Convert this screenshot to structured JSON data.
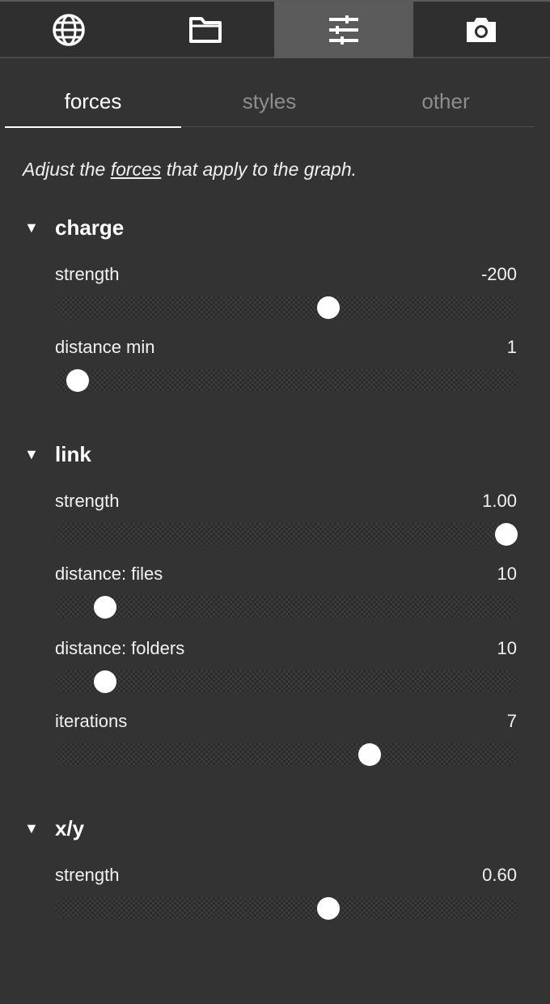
{
  "toolbar": {
    "buttons": [
      {
        "icon": "globe-icon"
      },
      {
        "icon": "folder-icon"
      },
      {
        "icon": "sliders-icon",
        "active": true
      },
      {
        "icon": "camera-icon"
      }
    ]
  },
  "tabs": [
    {
      "label": "forces",
      "active": true
    },
    {
      "label": "styles"
    },
    {
      "label": "other"
    }
  ],
  "intro": {
    "before": "Adjust the ",
    "link": "forces",
    "after": " that apply to the graph."
  },
  "sections": {
    "charge": {
      "caret": "▼",
      "title": "charge",
      "rows": [
        {
          "label": "strength",
          "value": "-200",
          "fraction": 0.596
        },
        {
          "label": "distance min",
          "value": "1",
          "fraction": 0.025
        }
      ]
    },
    "link": {
      "caret": "▼",
      "title": "link",
      "rows": [
        {
          "label": "strength",
          "value": "1.00",
          "fraction": 1.0
        },
        {
          "label": "distance: files",
          "value": "10",
          "fraction": 0.088
        },
        {
          "label": "distance: folders",
          "value": "10",
          "fraction": 0.088
        },
        {
          "label": "iterations",
          "value": "7",
          "fraction": 0.69
        }
      ]
    },
    "xy": {
      "caret": "▼",
      "title": "x/y",
      "rows": [
        {
          "label": "strength",
          "value": "0.60",
          "fraction": 0.596
        }
      ]
    }
  }
}
